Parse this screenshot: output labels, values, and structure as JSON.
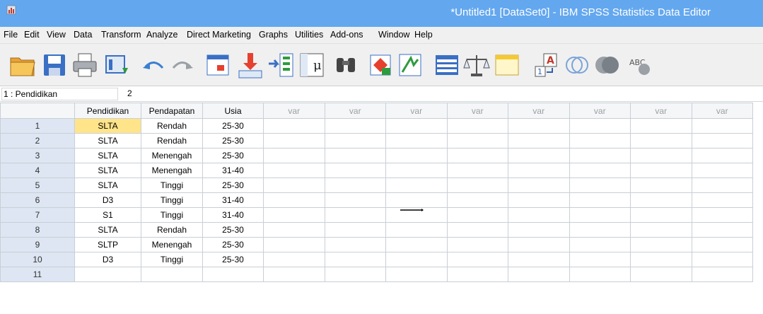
{
  "window": {
    "title": "*Untitled1 [DataSet0] - IBM SPSS Statistics Data Editor"
  },
  "menu": [
    "File",
    "Edit",
    "View",
    "Data",
    "Transform",
    "Analyze",
    "Direct Marketing",
    "Graphs",
    "Utilities",
    "Add-ons",
    "Window",
    "Help"
  ],
  "toolbar": {
    "icons": [
      "open-icon",
      "save-icon",
      "print-icon",
      "recall-dialog-icon",
      "undo-icon",
      "redo-icon",
      "goto-case-icon",
      "goto-variable-icon",
      "variables-icon",
      "descriptive-statistics-icon",
      "find-icon",
      "insert-cases-icon",
      "insert-variable-icon",
      "split-file-icon",
      "weight-cases-icon",
      "select-cases-icon",
      "value-labels-icon",
      "use-sets-icon",
      "show-all-variables-icon",
      "spell-check-icon"
    ]
  },
  "cell_editor": {
    "ref": "1 : Pendidikan",
    "value": "2"
  },
  "grid": {
    "columns": [
      "Pendidikan",
      "Pendapatan",
      "Usia",
      "var",
      "var",
      "var",
      "var",
      "var",
      "var",
      "var",
      "var"
    ],
    "rows": [
      {
        "n": "1",
        "cells": [
          "SLTA",
          "Rendah",
          "25-30"
        ]
      },
      {
        "n": "2",
        "cells": [
          "SLTA",
          "Rendah",
          "25-30"
        ]
      },
      {
        "n": "3",
        "cells": [
          "SLTA",
          "Menengah",
          "25-30"
        ]
      },
      {
        "n": "4",
        "cells": [
          "SLTA",
          "Menengah",
          "31-40"
        ]
      },
      {
        "n": "5",
        "cells": [
          "SLTA",
          "Tinggi",
          "25-30"
        ]
      },
      {
        "n": "6",
        "cells": [
          "D3",
          "Tinggi",
          "31-40"
        ]
      },
      {
        "n": "7",
        "cells": [
          "S1",
          "Tinggi",
          "31-40"
        ]
      },
      {
        "n": "8",
        "cells": [
          "SLTA",
          "Rendah",
          "25-30"
        ]
      },
      {
        "n": "9",
        "cells": [
          "SLTP",
          "Menengah",
          "25-30"
        ]
      },
      {
        "n": "10",
        "cells": [
          "D3",
          "Tinggi",
          "25-30"
        ]
      },
      {
        "n": "11",
        "cells": [
          "",
          "",
          ""
        ]
      }
    ]
  },
  "colors": {
    "titlebar": "#63a7ef",
    "selected_cell": "#ffe48a",
    "row_header": "#dde6f2",
    "grid_line": "#c8cfd6"
  }
}
